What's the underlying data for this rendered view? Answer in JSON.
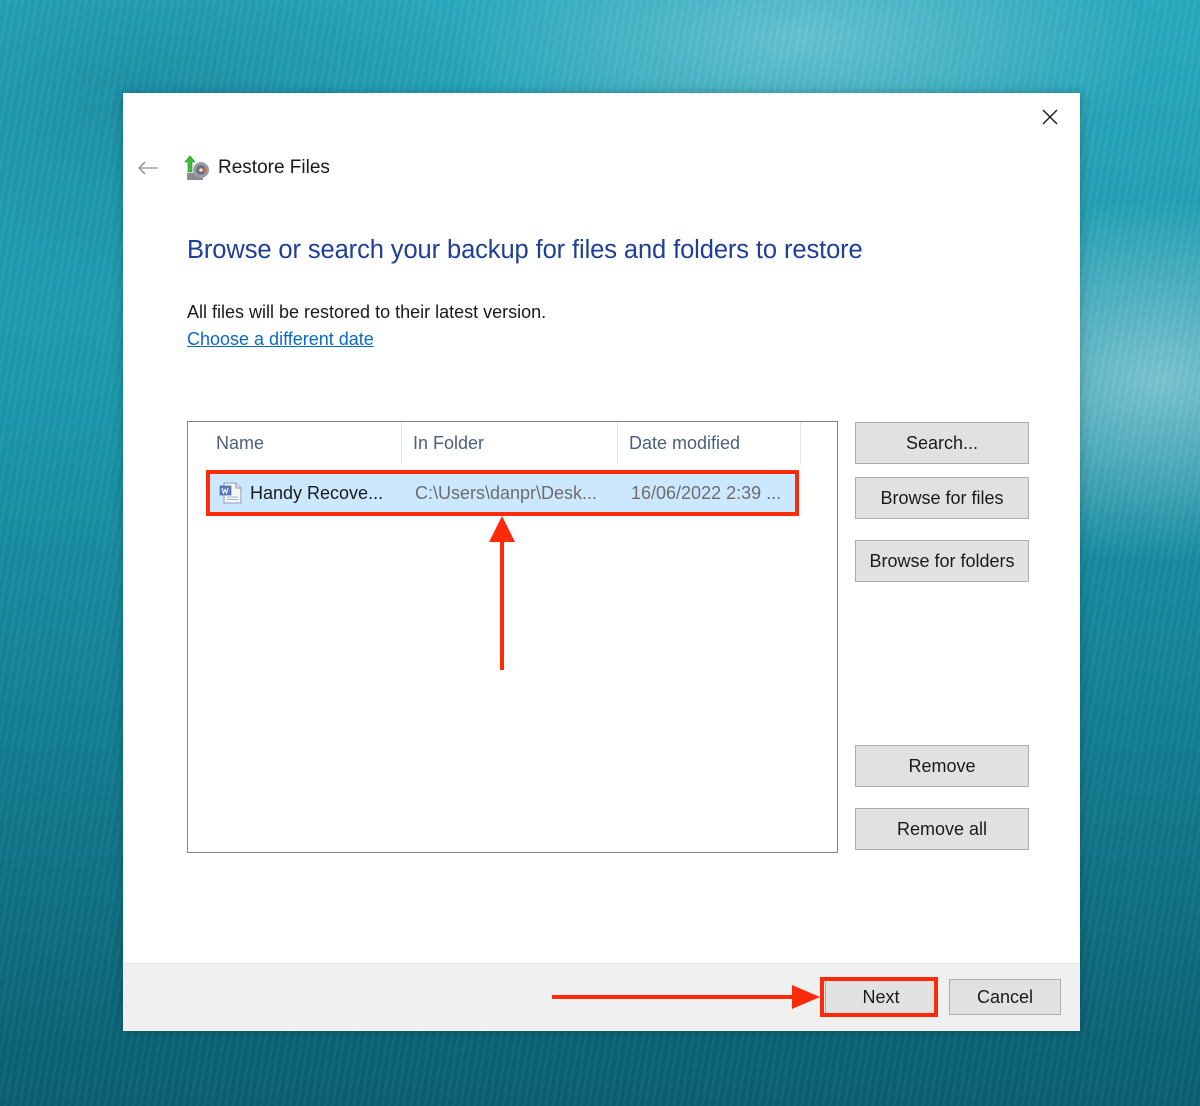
{
  "window": {
    "title": "Restore Files",
    "close_label": "Close",
    "back_label": "Back"
  },
  "main": {
    "heading": "Browse or search your backup for files and folders to restore",
    "info_text": "All files will be restored to their latest version.",
    "date_link": "Choose a different date"
  },
  "file_list": {
    "columns": [
      "Name",
      "In Folder",
      "Date modified"
    ],
    "rows": [
      {
        "icon": "document-icon",
        "name": "Handy Recove...",
        "folder": "C:\\Users\\danpr\\Desk...",
        "date": "16/06/2022 2:39 ...",
        "selected": true
      }
    ]
  },
  "side_buttons": {
    "search": "Search...",
    "browse_files": "Browse for files",
    "browse_folders": "Browse for folders",
    "remove": "Remove",
    "remove_all": "Remove all"
  },
  "footer": {
    "next": "Next",
    "cancel": "Cancel"
  },
  "annotations": {
    "highlight_color": "#ff2a0a"
  }
}
